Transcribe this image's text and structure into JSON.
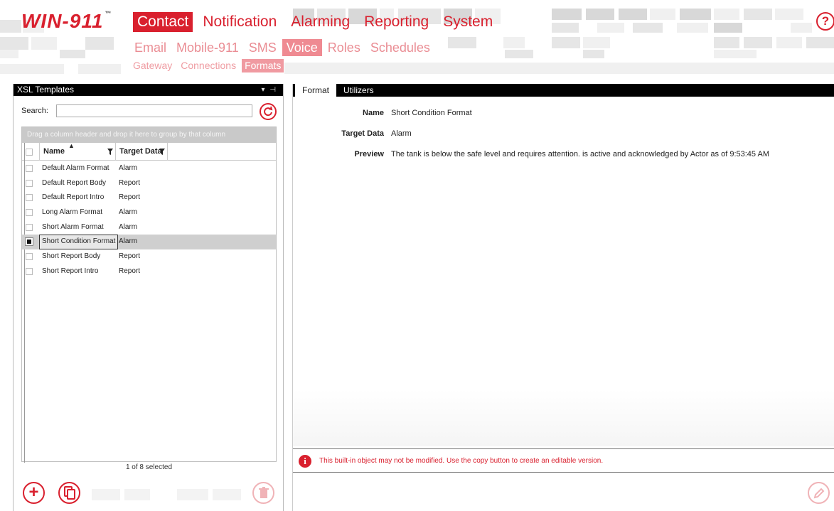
{
  "header": {
    "logo": "WIN-911",
    "logo_tm": "™",
    "help_label": "?",
    "nav_primary": [
      {
        "label": "Contact",
        "active": true
      },
      {
        "label": "Notification",
        "active": false
      },
      {
        "label": "Alarming",
        "active": false
      },
      {
        "label": "Reporting",
        "active": false
      },
      {
        "label": "System",
        "active": false
      }
    ],
    "nav_secondary": [
      {
        "label": "Email",
        "active": false
      },
      {
        "label": "Mobile-911",
        "active": false
      },
      {
        "label": "SMS",
        "active": false
      },
      {
        "label": "Voice",
        "active": true
      },
      {
        "label": "Roles",
        "active": false
      },
      {
        "label": "Schedules",
        "active": false
      }
    ],
    "nav_tertiary": [
      {
        "label": "Gateway",
        "active": false
      },
      {
        "label": "Connections",
        "active": false
      },
      {
        "label": "Formats",
        "active": true
      }
    ]
  },
  "left_panel": {
    "title": "XSL Templates",
    "pin_glyphs": "▾ ⊣",
    "search": {
      "label": "Search:",
      "value": "",
      "placeholder": ""
    },
    "group_hint": "Drag a column header and drop it here to group by that column",
    "columns": {
      "name": "Name",
      "target": "Target Data"
    },
    "rows": [
      {
        "name": "Default Alarm Format",
        "target": "Alarm",
        "selected": false
      },
      {
        "name": "Default Report Body",
        "target": "Report",
        "selected": false
      },
      {
        "name": "Default Report Intro",
        "target": "Report",
        "selected": false
      },
      {
        "name": "Long Alarm Format",
        "target": "Alarm",
        "selected": false
      },
      {
        "name": "Short Alarm Format",
        "target": "Alarm",
        "selected": false
      },
      {
        "name": "Short Condition Format",
        "target": "Alarm",
        "selected": true
      },
      {
        "name": "Short Report Body",
        "target": "Report",
        "selected": false
      },
      {
        "name": "Short Report Intro",
        "target": "Report",
        "selected": false
      }
    ],
    "count": "1 of 8 selected"
  },
  "right_panel": {
    "tabs": [
      {
        "label": "Format",
        "active": true
      },
      {
        "label": "Utilizers",
        "active": false
      }
    ],
    "fields": {
      "name_label": "Name",
      "name_value": "Short Condition Format",
      "target_label": "Target Data",
      "target_value": "Alarm",
      "preview_label": "Preview",
      "preview_value": "The tank is below the safe level and requires attention. is active and acknowledged by Actor as of 9:53:45 AM"
    },
    "warning": "This built-in object may not be modified. Use the copy button to create an editable version."
  },
  "colors": {
    "brand_red": "#d9202e",
    "selection_gray": "#cfcfcf"
  }
}
